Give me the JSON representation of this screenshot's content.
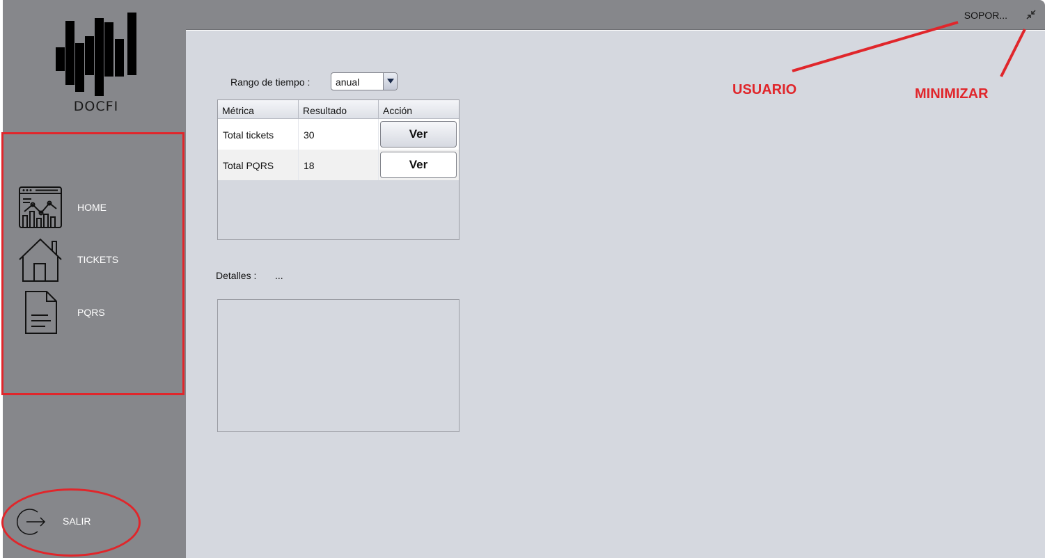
{
  "app": {
    "logo_text": "DOCFI"
  },
  "sidebar": {
    "items": [
      {
        "label": "HOME",
        "icon": "dashboard-chart-icon"
      },
      {
        "label": "TICKETS",
        "icon": "house-icon"
      },
      {
        "label": "PQRS",
        "icon": "document-icon"
      }
    ],
    "exit": {
      "label": "SALIR",
      "icon": "logout-icon"
    }
  },
  "header": {
    "user": "SOPOR...",
    "minimize_icon": "minimize-icon"
  },
  "filters": {
    "range_label": "Rango de tiempo :",
    "range_value": "anual"
  },
  "table": {
    "columns": [
      "Métrica",
      "Resultado",
      "Acción"
    ],
    "rows": [
      {
        "metric": "Total tickets",
        "result": "30",
        "action": "Ver"
      },
      {
        "metric": "Total PQRS",
        "result": "18",
        "action": "Ver"
      }
    ]
  },
  "details": {
    "label": "Detalles :",
    "value": "..."
  },
  "annotations": {
    "user": "USUARIO",
    "minimize": "MINIMIZAR",
    "color": "#e0262b"
  },
  "colors": {
    "sidebar": "#86878b",
    "main": "#d5d8df",
    "nav_text": "#ffffff"
  }
}
